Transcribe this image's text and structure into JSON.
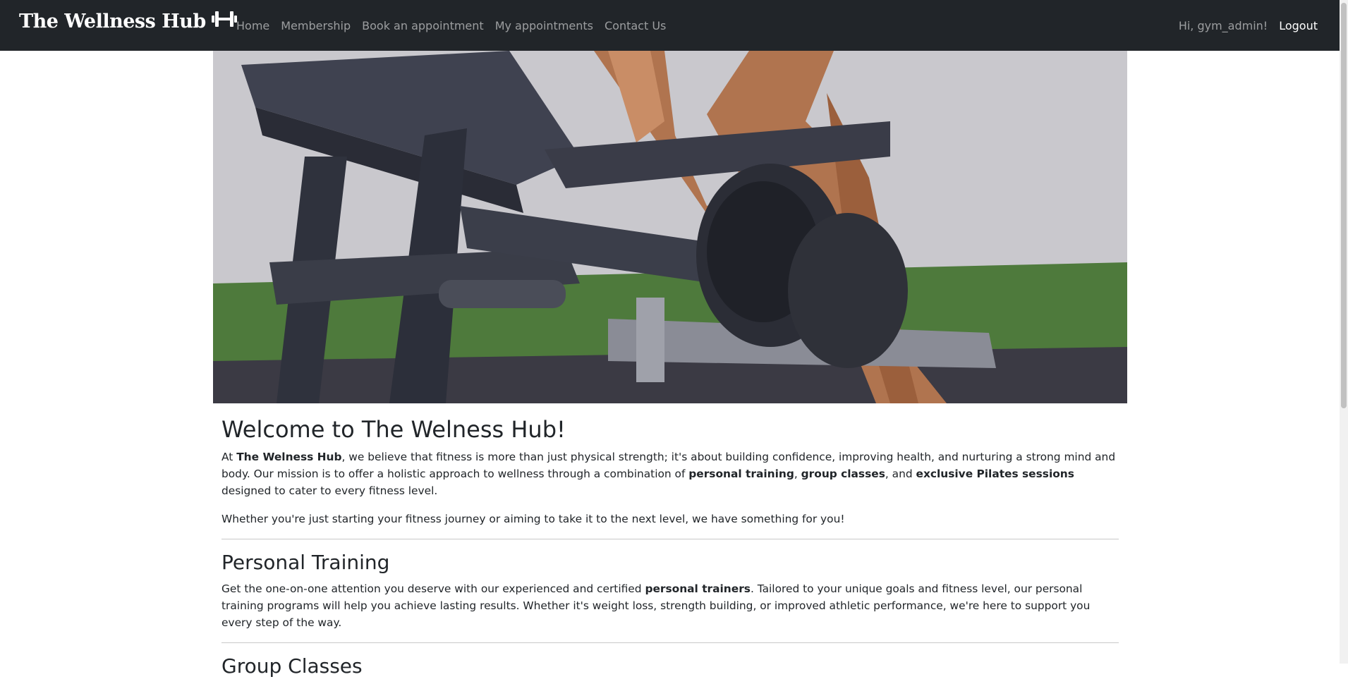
{
  "navbar": {
    "brand": "The Wellness Hub",
    "brand_icon": "dumbbell-icon",
    "links": [
      "Home",
      "Membership",
      "Book an appointment",
      "My appointments",
      "Contact Us"
    ],
    "greeting": "Hi, gym_admin!",
    "logout": "Logout"
  },
  "colors": {
    "navbar_bg": "#212529",
    "text": "#212529"
  },
  "hero": {
    "description": "gym bench and dumbbell photo"
  },
  "welcome": {
    "title": "Welcome to The Welness Hub!",
    "p1_a": "At ",
    "p1_b": "The Welness Hub",
    "p1_c": ", we believe that fitness is more than just physical strength; it's about building confidence, improving health, and nurturing a strong mind and body. Our mission is to offer a holistic approach to wellness through a combination of ",
    "p1_d": "personal training",
    "p1_e": ", ",
    "p1_f": "group classes",
    "p1_g": ", and ",
    "p1_h": "exclusive Pilates sessions",
    "p1_i": " designed to cater to every fitness level.",
    "p2": "Whether you're just starting your fitness journey or aiming to take it to the next level, we have something for you!"
  },
  "personal_training": {
    "title": "Personal Training",
    "p_a": "Get the one-on-one attention you deserve with our experienced and certified ",
    "p_b": "personal trainers",
    "p_c": ". Tailored to your unique goals and fitness level, our personal training programs will help you achieve lasting results. Whether it's weight loss, strength building, or improved athletic performance, we're here to support you every step of the way."
  },
  "group_classes": {
    "title": "Group Classes"
  }
}
